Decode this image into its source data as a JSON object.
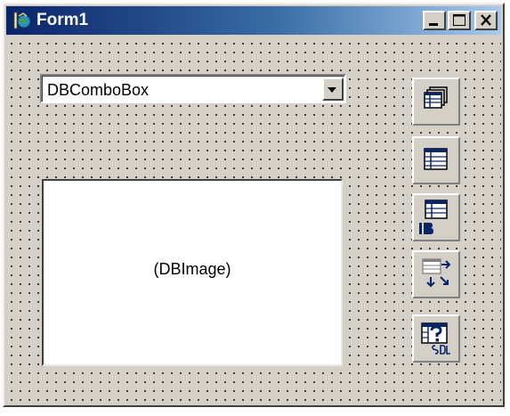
{
  "window": {
    "title": "Form1",
    "app_icon": "delphi-helmet-icon",
    "caption_buttons": [
      "minimize-icon",
      "maximize-icon",
      "close-icon"
    ]
  },
  "form": {
    "combo": {
      "value": "DBComboBox",
      "arrow_icon": "chevron-down-icon"
    },
    "image": {
      "label": "(DBImage)"
    },
    "components": [
      {
        "icon": "database-icon"
      },
      {
        "icon": "table-icon"
      },
      {
        "icon": "ibtable-icon"
      },
      {
        "icon": "batchmove-icon"
      },
      {
        "icon": "query-icon"
      }
    ]
  },
  "colors": {
    "titlebar_start": "#0a246a",
    "titlebar_end": "#a6caf0",
    "face": "#d4d0c8",
    "icon_blue": "#0a246a"
  }
}
